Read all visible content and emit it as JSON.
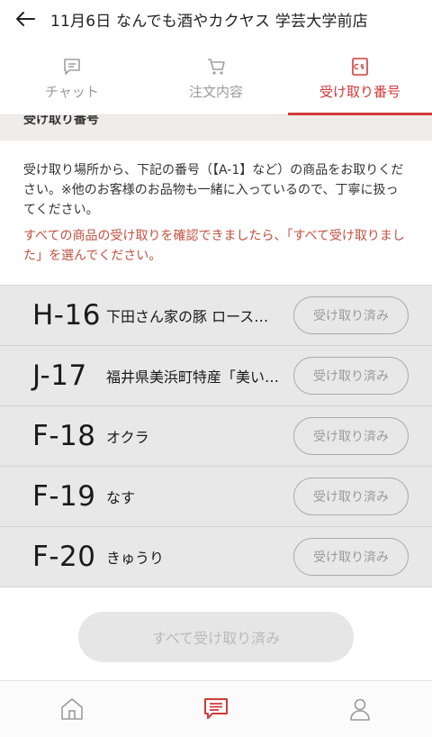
{
  "header": {
    "title": "11月6日 なんでも酒やカクヤス 学芸大学前店",
    "back_icon": "arrow-left-icon"
  },
  "tabs": [
    {
      "label": "チャット",
      "icon": "chat-icon",
      "active": false
    },
    {
      "label": "注文内容",
      "icon": "cart-icon",
      "active": false
    },
    {
      "label": "受け取り番号",
      "icon": "ticket-icon",
      "active": true
    }
  ],
  "section": {
    "title": "受け取り番号"
  },
  "info": {
    "description": "受け取り場所から、下記の番号（【A-1】など）の商品をお取りください。※他のお客様のお品物も一緒に入っているので、丁寧に扱ってください。",
    "warning": "すべての商品の受け取りを確認できましたら、「すべて受け取りました」を選んでください。"
  },
  "items": [
    {
      "code": "H-16",
      "name": "下田さん家の豚 ロース…",
      "button": "受け取り済み"
    },
    {
      "code": "J-17",
      "name": "福井県美浜町特産「美い…",
      "button": "受け取り済み"
    },
    {
      "code": "F-18",
      "name": "オクラ",
      "button": "受け取り済み"
    },
    {
      "code": "F-19",
      "name": "なす",
      "button": "受け取り済み"
    },
    {
      "code": "F-20",
      "name": "きゅうり",
      "button": "受け取り済み"
    }
  ],
  "all_received_button": "すべて受け取り済み",
  "bottom_nav": [
    {
      "icon": "home-icon",
      "active": false
    },
    {
      "icon": "message-icon",
      "active": true
    },
    {
      "icon": "profile-icon",
      "active": false
    }
  ],
  "colors": {
    "accent": "#d23a3a",
    "warning_text": "#c2503f",
    "inactive": "#9a9a9a",
    "list_bg": "#e8e8e8"
  }
}
